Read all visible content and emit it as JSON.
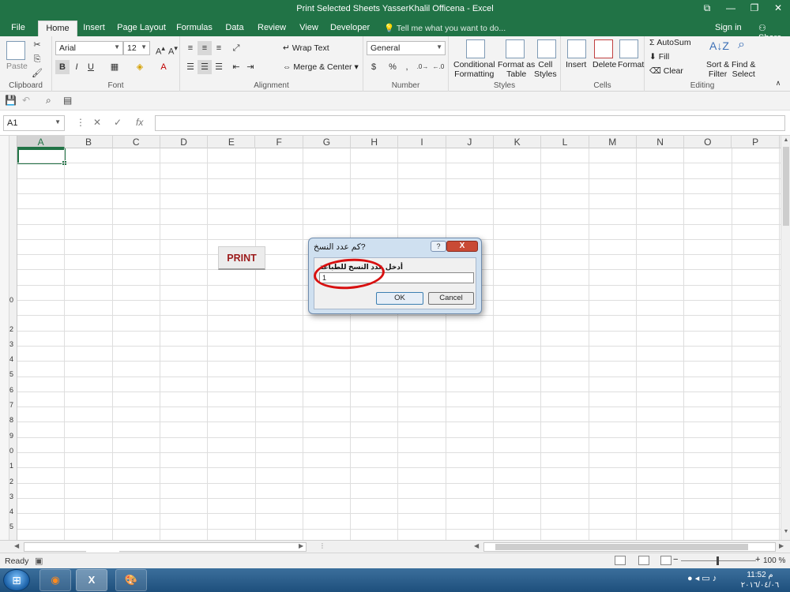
{
  "window": {
    "title": "Print Selected Sheets YasserKhalil Officena - Excel",
    "controls": [
      "restore-ribbon-icon",
      "minimize-icon",
      "restore-icon",
      "close-icon"
    ]
  },
  "tabs": {
    "file": "File",
    "home": "Home",
    "insert": "Insert",
    "page_layout": "Page Layout",
    "formulas": "Formulas",
    "data": "Data",
    "review": "Review",
    "view": "View",
    "developer": "Developer",
    "tell_me": "Tell me what you want to do...",
    "sign_in": "Sign in",
    "share": "Share"
  },
  "ribbon": {
    "clipboard": {
      "label": "Clipboard",
      "paste": "Paste"
    },
    "font": {
      "label": "Font",
      "name": "Arial",
      "size": "12",
      "bold": "B",
      "italic": "I",
      "underline": "U"
    },
    "alignment": {
      "label": "Alignment",
      "wrap_text": "Wrap Text",
      "merge_center": "Merge & Center"
    },
    "number": {
      "label": "Number",
      "format": "General",
      "percent": "%"
    },
    "styles": {
      "label": "Styles",
      "conditional": "Conditional",
      "conditional2": "Formatting",
      "format_as": "Format as",
      "format_as2": "Table",
      "cell": "Cell",
      "cell2": "Styles"
    },
    "cells": {
      "label": "Cells",
      "insert": "Insert",
      "delete": "Delete",
      "format": "Format"
    },
    "editing": {
      "label": "Editing",
      "autosum": "AutoSum",
      "fill": "Fill",
      "clear": "Clear",
      "sort": "Sort &",
      "sort2": "Filter",
      "find": "Find &",
      "find2": "Select"
    }
  },
  "formula_bar": {
    "name_box": "A1",
    "fx": "fx",
    "value": ""
  },
  "grid": {
    "columns": [
      "A",
      "B",
      "C",
      "D",
      "E",
      "F",
      "G",
      "H",
      "I",
      "J",
      "K",
      "L",
      "M",
      "N",
      "O",
      "P"
    ],
    "selected_cell": "A1",
    "row_digits_visible": [
      "0",
      "2",
      "3",
      "4",
      "5",
      "6",
      "7",
      "8",
      "9",
      "0",
      "1",
      "2",
      "3",
      "4",
      "5"
    ]
  },
  "sheet": {
    "print_button": "PRINT"
  },
  "dialog": {
    "title": "?كم عدد النسخ",
    "help": "?",
    "close": "X",
    "prompt": "أدخل عدد النسخ للطباعة",
    "input_value": "1",
    "ok": "OK",
    "cancel": "Cancel"
  },
  "status": {
    "ready": "Ready",
    "zoom": "100 %"
  },
  "taskbar": {
    "apps": [
      "firefox-icon",
      "excel-icon",
      "paint-icon"
    ],
    "time": "11:52 م",
    "date": "٢٠١٦/٠٤/٠٦"
  },
  "colors": {
    "excel_green": "#217346",
    "print_text": "#9c1c1c",
    "circle_red": "#d81010"
  }
}
